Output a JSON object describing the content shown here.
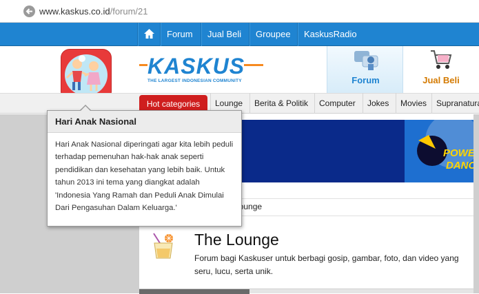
{
  "browser": {
    "url_domain": "www.kaskus.co.id",
    "url_path": "/forum/21"
  },
  "topnav": {
    "items": [
      "Forum",
      "Jual Beli",
      "Groupee",
      "KaskusRadio"
    ]
  },
  "logo": {
    "name": "KASKUS",
    "tagline": "THE LARGEST INDONESIAN COMMUNITY"
  },
  "tabs": {
    "forum": "Forum",
    "jual_beli": "Jual Beli"
  },
  "categories": {
    "hot": "Hot categories",
    "items": [
      "Lounge",
      "Berita & Politik",
      "Computer",
      "Jokes",
      "Movies",
      "Supranatural"
    ]
  },
  "banner": {
    "text1": "POWER",
    "text2": "DANCE"
  },
  "breadcrumb": {
    "current": "Lounge"
  },
  "forum": {
    "title": "The Lounge",
    "description": "Forum bagi Kaskuser untuk berbagi gosip, gambar, foto, dan video yang seru, lucu, serta unik."
  },
  "tooltip": {
    "title": "Hari Anak Nasional",
    "body": "Hari Anak Nasional diperingati agar kita lebih peduli terhadap pemenuhan hak-hak anak seperti pendidikan dan kesehatan yang lebih baik. Untuk tahun 2013 ini tema yang diangkat adalah 'Indonesia Yang Ramah dan Peduli Anak Dimulai Dari Pengasuhan Dalam Keluarga.'"
  },
  "colors": {
    "nav_blue": "#1f84d1",
    "hot_red": "#cf1e1e",
    "accent_orange": "#f68a1f"
  },
  "icons": [
    "back-arrow-icon",
    "globe-icon",
    "home-icon",
    "forum-tab-icon",
    "shopping-cart-icon",
    "lounge-drink-icon"
  ]
}
